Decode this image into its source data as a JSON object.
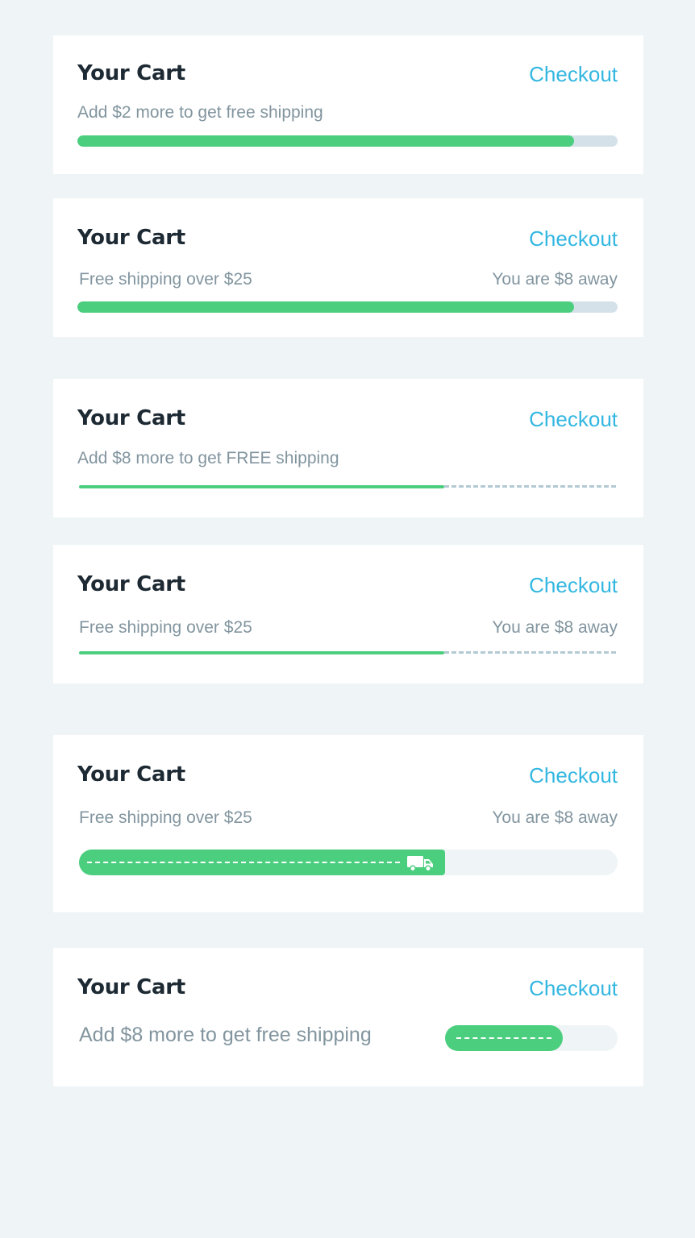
{
  "colors": {
    "background": "#eff4f7",
    "card": "#ffffff",
    "title": "#1d2a33",
    "accent_link": "#33b7e1",
    "muted_text": "#82959f",
    "progress_green": "#4cce7f",
    "track_gray": "#d5e1e8"
  },
  "cards": [
    {
      "title": "Your Cart",
      "checkout_label": "Checkout",
      "message": "Add $2 more to get free shipping",
      "progress": 0.92
    },
    {
      "title": "Your Cart",
      "checkout_label": "Checkout",
      "message": "Free shipping over $25",
      "away_text": "You are $8 away",
      "progress": 0.92
    },
    {
      "title": "Your Cart",
      "checkout_label": "Checkout",
      "message": "Add $8 more to get FREE shipping",
      "progress": 0.68
    },
    {
      "title": "Your Cart",
      "checkout_label": "Checkout",
      "message": "Free shipping over $25",
      "away_text": "You are $8 away",
      "progress": 0.68
    },
    {
      "title": "Your Cart",
      "checkout_label": "Checkout",
      "message": "Free shipping over $25",
      "away_text": "You are $8 away",
      "progress": 0.68,
      "icon": "truck-icon"
    },
    {
      "title": "Your Cart",
      "checkout_label": "Checkout",
      "message": "Add $8 more to get free shipping",
      "progress": 0.68
    }
  ]
}
